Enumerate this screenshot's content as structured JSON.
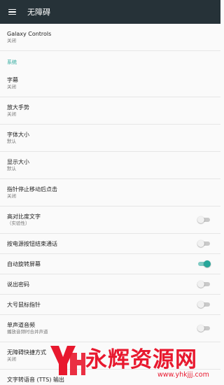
{
  "toolbar": {
    "title": "无障碍",
    "menu_icon": "hamburger-menu-icon"
  },
  "settings": {
    "galaxy": {
      "title": "Galaxy Controls",
      "summary": "关闭"
    },
    "category_system": "系统",
    "captions": {
      "title": "字幕",
      "summary": "关闭"
    },
    "magnification": {
      "title": "放大手势",
      "summary": "关闭"
    },
    "font_size": {
      "title": "字体大小",
      "summary": "默认"
    },
    "display_size": {
      "title": "显示大小",
      "summary": "默认"
    },
    "click_after_stop": {
      "title": "指针停止移动后点击",
      "summary": "关闭"
    },
    "high_contrast": {
      "title": "高对比度文字",
      "summary": "（实验性）",
      "on": false
    },
    "power_ends_call": {
      "title": "按电源按钮结束通话",
      "on": false
    },
    "auto_rotate": {
      "title": "自动旋转屏幕",
      "on": true
    },
    "speak_passwords": {
      "title": "说出密码",
      "on": false
    },
    "large_pointer": {
      "title": "大号鼠标指针",
      "on": false
    },
    "mono_audio": {
      "title": "单声道音频",
      "summary": "播放音频时合并声道",
      "on": false
    },
    "shortcut": {
      "title": "无障碍快捷方式",
      "summary": "关闭"
    },
    "tts": {
      "title": "文字转语音 (TTS) 输出"
    }
  },
  "colors": {
    "toolbar": "#263238",
    "accent": "#26a69a",
    "watermark": "#e8182e"
  },
  "watermark": {
    "brand": "永辉资源网",
    "url": "www.yhkjjj.com"
  }
}
